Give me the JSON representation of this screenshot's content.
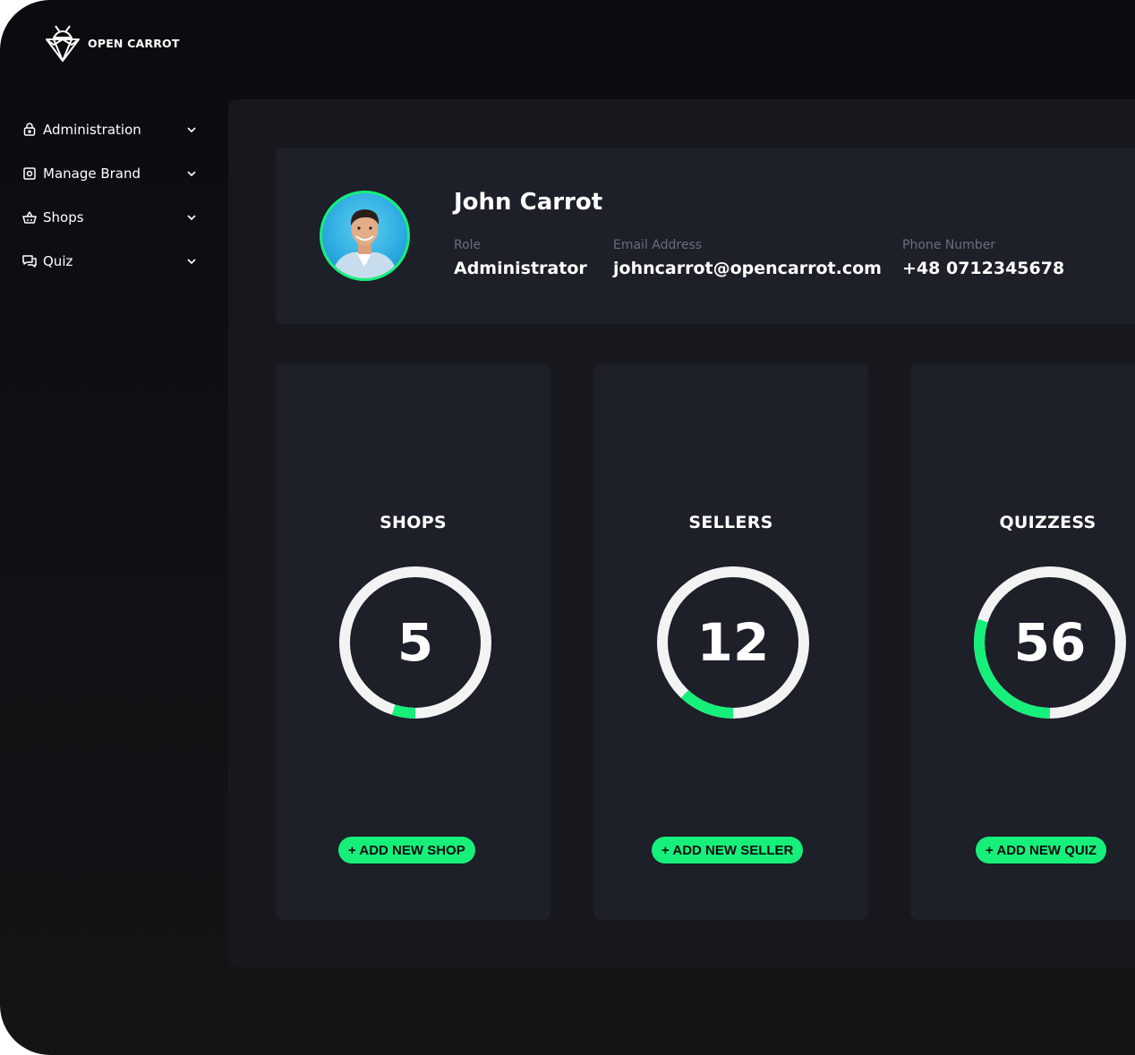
{
  "brand": {
    "name": "OPEN CARROT",
    "accent": "#16f07a",
    "logo_icon": "diamond-carrot-logo"
  },
  "sidebar": {
    "items": [
      {
        "label": "Administration",
        "icon": "lock-icon"
      },
      {
        "label": "Manage Brand",
        "icon": "brand-icon"
      },
      {
        "label": "Shops",
        "icon": "basket-icon"
      },
      {
        "label": "Quiz",
        "icon": "chat-icon"
      }
    ]
  },
  "profile": {
    "name": "John Carrot",
    "role_label": "Role",
    "role_value": "Administrator",
    "email_label": "Email Address",
    "email_value": "johncarrot@opencarrot.com",
    "phone_label": "Phone Number",
    "phone_value": "+48 0712345678"
  },
  "stats": [
    {
      "title": "SHOPS",
      "value": "5",
      "progress": 0.05,
      "button": "+ ADD NEW SHOP"
    },
    {
      "title": "SELLERS",
      "value": "12",
      "progress": 0.12,
      "button": "+ ADD NEW SELLER"
    },
    {
      "title": "QUIZZESS",
      "value": "56",
      "progress": 0.3,
      "button": "+ ADD NEW QUIZ"
    }
  ]
}
